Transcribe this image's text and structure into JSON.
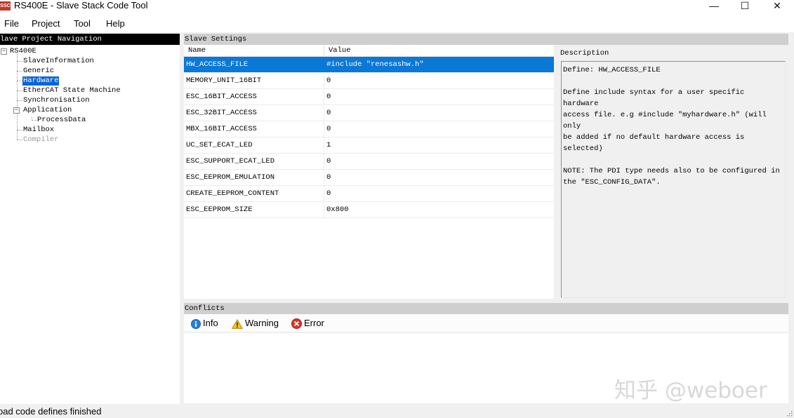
{
  "window": {
    "icon_text": "SSC",
    "title": "RS400E - Slave Stack Code Tool",
    "minimize": "—",
    "maximize": "☐",
    "close": "✕"
  },
  "menu": {
    "file": "File",
    "project": "Project",
    "tool": "Tool",
    "help": "Help"
  },
  "nav": {
    "header": "lave Project Navigation",
    "root": "RS400E",
    "items": {
      "slave_information": "SlaveInformation",
      "generic": "Generic",
      "hardware": "Hardware",
      "ethercat": "EtherCAT State Machine",
      "synchronisation": "Synchronisation",
      "application": "Application",
      "process_data": "ProcessData",
      "mailbox": "Mailbox",
      "compiler": "Compiler"
    },
    "selected": "Hardware"
  },
  "settings": {
    "header": "Slave Settings",
    "col_name": "Name",
    "col_value": "Value",
    "rows": [
      {
        "name": "HW_ACCESS_FILE",
        "value": "#include \"renesashw.h\""
      },
      {
        "name": "MEMORY_UNIT_16BIT",
        "value": "0"
      },
      {
        "name": "ESC_16BIT_ACCESS",
        "value": "0"
      },
      {
        "name": "ESC_32BIT_ACCESS",
        "value": "0"
      },
      {
        "name": "MBX_16BIT_ACCESS",
        "value": "0"
      },
      {
        "name": "UC_SET_ECAT_LED",
        "value": "1"
      },
      {
        "name": "ESC_SUPPORT_ECAT_LED",
        "value": "0"
      },
      {
        "name": "ESC_EEPROM_EMULATION",
        "value": "0"
      },
      {
        "name": "CREATE_EEPROM_CONTENT",
        "value": "0"
      },
      {
        "name": "ESC_EEPROM_SIZE",
        "value": "0x800"
      }
    ],
    "selected_row": "HW_ACCESS_FILE"
  },
  "description": {
    "label": "Description",
    "text": "Define: HW_ACCESS_FILE\n\nDefine include syntax for a user specific hardware\naccess file. e.g #include \"myhardware.h\" (will only\nbe added if no default hardware access is selected)\n\nNOTE: The PDI type needs also to be configured in\nthe \"ESC_CONFIG_DATA\"."
  },
  "conflicts": {
    "header": "Conflicts",
    "info": "Info",
    "warning": "Warning",
    "error": "Error"
  },
  "watermark": "知乎 @weboer",
  "status": "oad code defines finished",
  "colors": {
    "selection": "#0a78d7",
    "tree_selection": "#0a64d8",
    "nav_header": "#000000"
  }
}
